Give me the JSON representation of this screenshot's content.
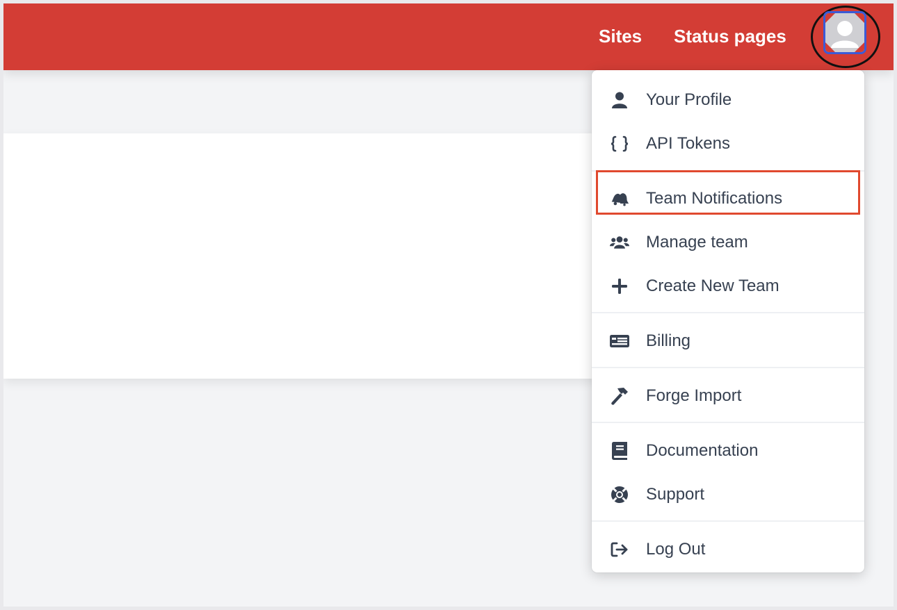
{
  "topbar": {
    "background": "#d33d35",
    "nav": [
      {
        "label": "Sites"
      },
      {
        "label": "Status pages"
      }
    ],
    "avatar": {
      "icon": "user-avatar-icon",
      "border_color": "#3b5bd6"
    }
  },
  "dropdown": {
    "items": [
      {
        "label": "Your Profile",
        "icon": "user-icon"
      },
      {
        "label": "API Tokens",
        "icon": "braces-icon"
      },
      {
        "label": "Team Notifications",
        "icon": "bells-icon",
        "highlighted": true
      },
      {
        "label": "Manage team",
        "icon": "users-icon"
      },
      {
        "label": "Create New Team",
        "icon": "plus-icon"
      },
      {
        "label": "Billing",
        "icon": "money-bill-icon"
      },
      {
        "label": "Forge Import",
        "icon": "hammer-icon"
      },
      {
        "label": "Documentation",
        "icon": "book-icon"
      },
      {
        "label": "Support",
        "icon": "life-ring-icon"
      },
      {
        "label": "Log Out",
        "icon": "sign-out-icon"
      }
    ]
  },
  "colors": {
    "accent": "#d33d35",
    "highlight_border": "#e0492f",
    "menu_text": "#374151"
  }
}
